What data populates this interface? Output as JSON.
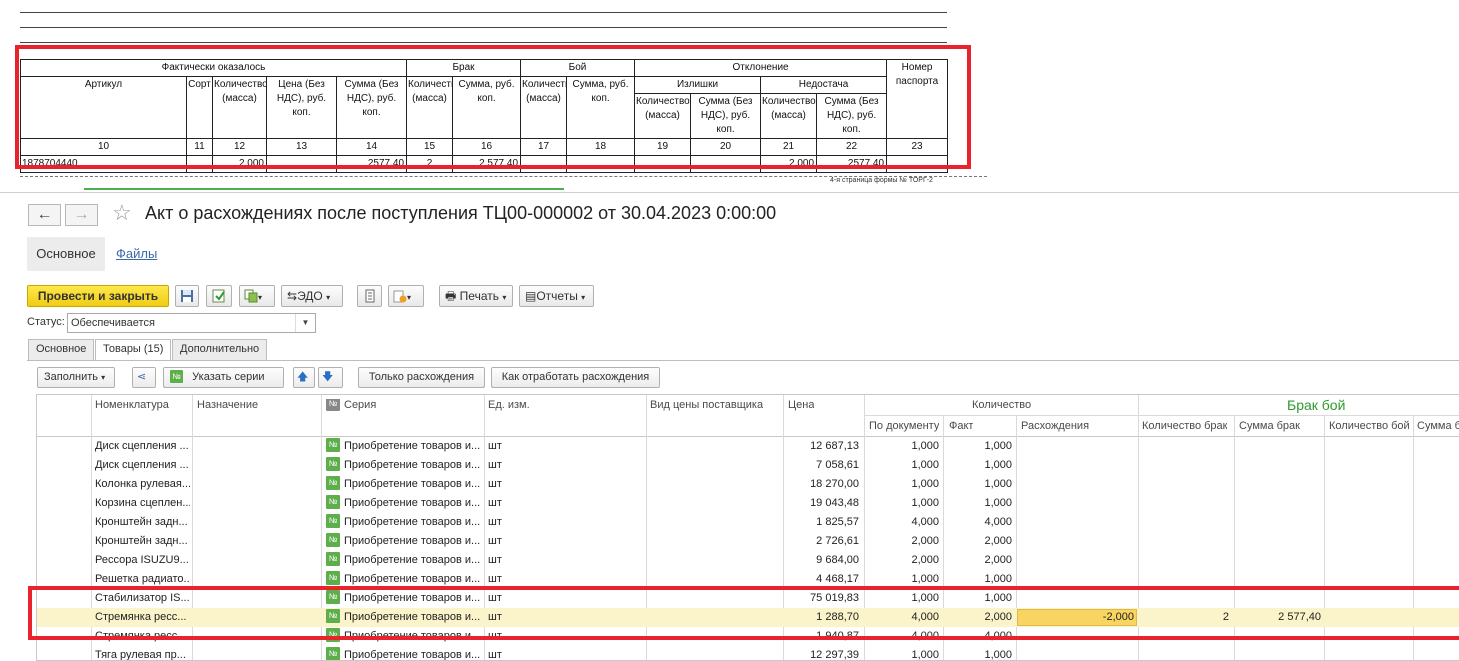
{
  "print_form": {
    "header_groups": {
      "actual": "Фактически оказалось",
      "defect": "Брак",
      "broken": "Бой",
      "deviation": "Отклонение",
      "passport": "Номер паспорта",
      "surplus": "Излишки",
      "shortage": "Недостача"
    },
    "columns": {
      "article": "Артикул",
      "grade": "Сорт",
      "qty": "Количество (масса)",
      "price": "Цена (Без НДС), руб. коп.",
      "sum": "Сумма (Без НДС), руб. коп.",
      "defect_qty": "Количество (масса)",
      "defect_sum": "Сумма, руб. коп.",
      "broken_qty": "Количество (масса)",
      "broken_sum": "Сумма, руб. коп.",
      "surplus_qty": "Количество (масса)",
      "surplus_sum": "Сумма (Без НДС), руб. коп.",
      "shortage_qty": "Количество (масса)",
      "shortage_sum": "Сумма (Без НДС), руб. коп."
    },
    "column_numbers": [
      "10",
      "11",
      "12",
      "13",
      "14",
      "15",
      "16",
      "17",
      "18",
      "19",
      "20",
      "21",
      "22",
      "23"
    ],
    "row": {
      "article": "1878704440",
      "grade": "",
      "qty": "2,000",
      "price": "",
      "sum": "2577,40",
      "defect_qty": "2",
      "defect_sum": "2 577,40",
      "broken_qty": "",
      "broken_sum": "",
      "surplus_qty": "",
      "surplus_sum": "",
      "shortage_qty": "2,000",
      "shortage_sum": "2577,40",
      "passport": ""
    },
    "page_footer": "4-я страница формы № ТОРГ-2"
  },
  "window": {
    "title": "Акт о расхождениях после поступления ТЦ00-000002 от 30.04.2023 0:00:00",
    "nav_back": "←",
    "nav_forward": "→",
    "favorite_icon": "star-icon",
    "tabs": {
      "main": "Основное",
      "files": "Файлы"
    },
    "toolbar": {
      "post_close": "Провести и закрыть",
      "edo": "ЭДО",
      "print": "Печать",
      "reports": "Отчеты"
    },
    "status_label": "Статус:",
    "status_value": "Обеспечивается",
    "page_tabs": [
      "Основное",
      "Товары (15)",
      "Дополнительно"
    ],
    "grid_toolbar": {
      "fill": "Заполнить",
      "series": "Указать серии",
      "only_disc": "Только расхождения",
      "how_to": "Как отработать расхождения"
    }
  },
  "grid": {
    "headers": {
      "nomenclature": "Номенклатура",
      "purpose": "Назначение",
      "series": "Серия",
      "unit": "Ед. изм.",
      "price_kind": "Вид цены поставщика",
      "price": "Цена",
      "qty_group": "Количество",
      "by_doc": "По документу",
      "fact": "Факт",
      "disc": "Расхождения",
      "defect_group": "Брак бой",
      "defect_qty": "Количество брак",
      "defect_sum": "Сумма брак",
      "broken_qty": "Количество бой",
      "broken_sum": "Сумма б"
    },
    "rows": [
      {
        "name": "Диск сцепления ...",
        "series": "Приобретение товаров и...",
        "unit": "шт",
        "price": "12 687,13",
        "doc": "1,000",
        "fact": "1,000"
      },
      {
        "name": "Диск сцепления ...",
        "series": "Приобретение товаров и...",
        "unit": "шт",
        "price": "7 058,61",
        "doc": "1,000",
        "fact": "1,000"
      },
      {
        "name": "Колонка рулевая...",
        "series": "Приобретение товаров и...",
        "unit": "шт",
        "price": "18 270,00",
        "doc": "1,000",
        "fact": "1,000"
      },
      {
        "name": "Корзина сцеплен...",
        "series": "Приобретение товаров и...",
        "unit": "шт",
        "price": "19 043,48",
        "doc": "1,000",
        "fact": "1,000"
      },
      {
        "name": "Кронштейн задн...",
        "series": "Приобретение товаров и...",
        "unit": "шт",
        "price": "1 825,57",
        "doc": "4,000",
        "fact": "4,000"
      },
      {
        "name": "Кронштейн задн...",
        "series": "Приобретение товаров и...",
        "unit": "шт",
        "price": "2 726,61",
        "doc": "2,000",
        "fact": "2,000"
      },
      {
        "name": "Рессора ISUZU9...",
        "series": "Приобретение товаров и...",
        "unit": "шт",
        "price": "9 684,00",
        "doc": "2,000",
        "fact": "2,000"
      },
      {
        "name": "Решетка радиато...",
        "series": "Приобретение товаров и...",
        "unit": "шт",
        "price": "4 468,17",
        "doc": "1,000",
        "fact": "1,000"
      },
      {
        "name": "Стабилизатор IS...",
        "series": "Приобретение товаров и...",
        "unit": "шт",
        "price": "75 019,83",
        "doc": "1,000",
        "fact": "1,000"
      },
      {
        "name": "Стремянка ресс...",
        "series": "Приобретение товаров и...",
        "unit": "шт",
        "price": "1 288,70",
        "doc": "4,000",
        "fact": "2,000",
        "disc": "-2,000",
        "defect_qty": "2",
        "defect_sum": "2 577,40",
        "selected": true
      },
      {
        "name": "Стремянка ресс...",
        "series": "Приобретение товаров и...",
        "unit": "шт",
        "price": "1 940,87",
        "doc": "4,000",
        "fact": "4,000"
      },
      {
        "name": "Тяга рулевая пр...",
        "series": "Приобретение товаров и...",
        "unit": "шт",
        "price": "12 297,39",
        "doc": "1,000",
        "fact": "1,000"
      }
    ]
  },
  "colors": {
    "highlight_red": "#e8232b",
    "post_button": "#f5d31e",
    "series_badge": "#5fae4c",
    "defect_header": "#2e9b2e",
    "selected_row": "#fbf3c9"
  }
}
